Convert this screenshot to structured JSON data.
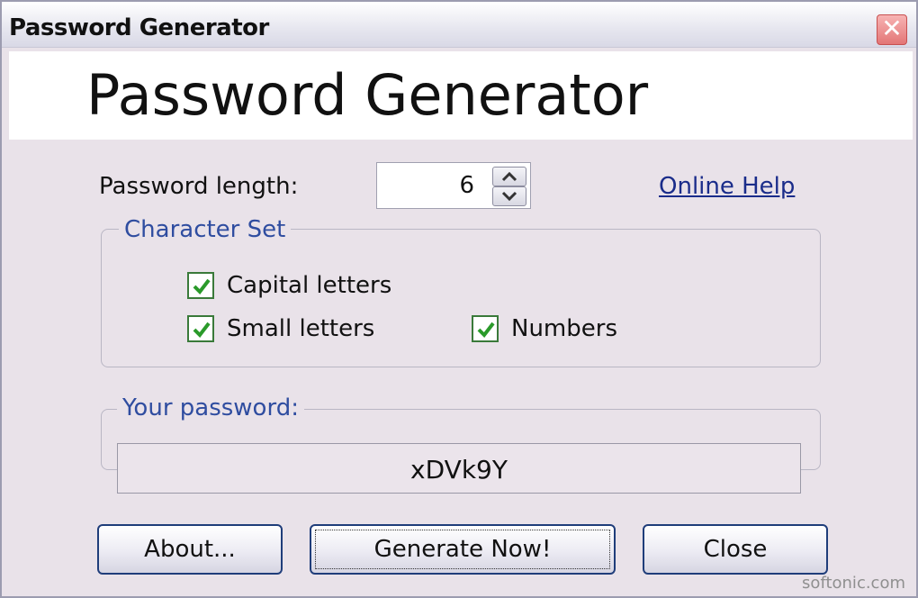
{
  "window": {
    "title": "Password Generator",
    "close_glyph": "✕"
  },
  "header": {
    "title": "Password Generator"
  },
  "length": {
    "label": "Password length:",
    "value": "6"
  },
  "help": {
    "label": "Online Help"
  },
  "charset": {
    "legend": "Character Set",
    "capital": {
      "label": "Capital letters",
      "checked": true
    },
    "small": {
      "label": "Small letters",
      "checked": true
    },
    "numbers": {
      "label": "Numbers",
      "checked": true
    }
  },
  "password": {
    "legend": "Your password:",
    "value": "xDVk9Y"
  },
  "buttons": {
    "about": "About...",
    "generate": "Generate Now!",
    "close": "Close"
  },
  "watermark": "softonic.com"
}
